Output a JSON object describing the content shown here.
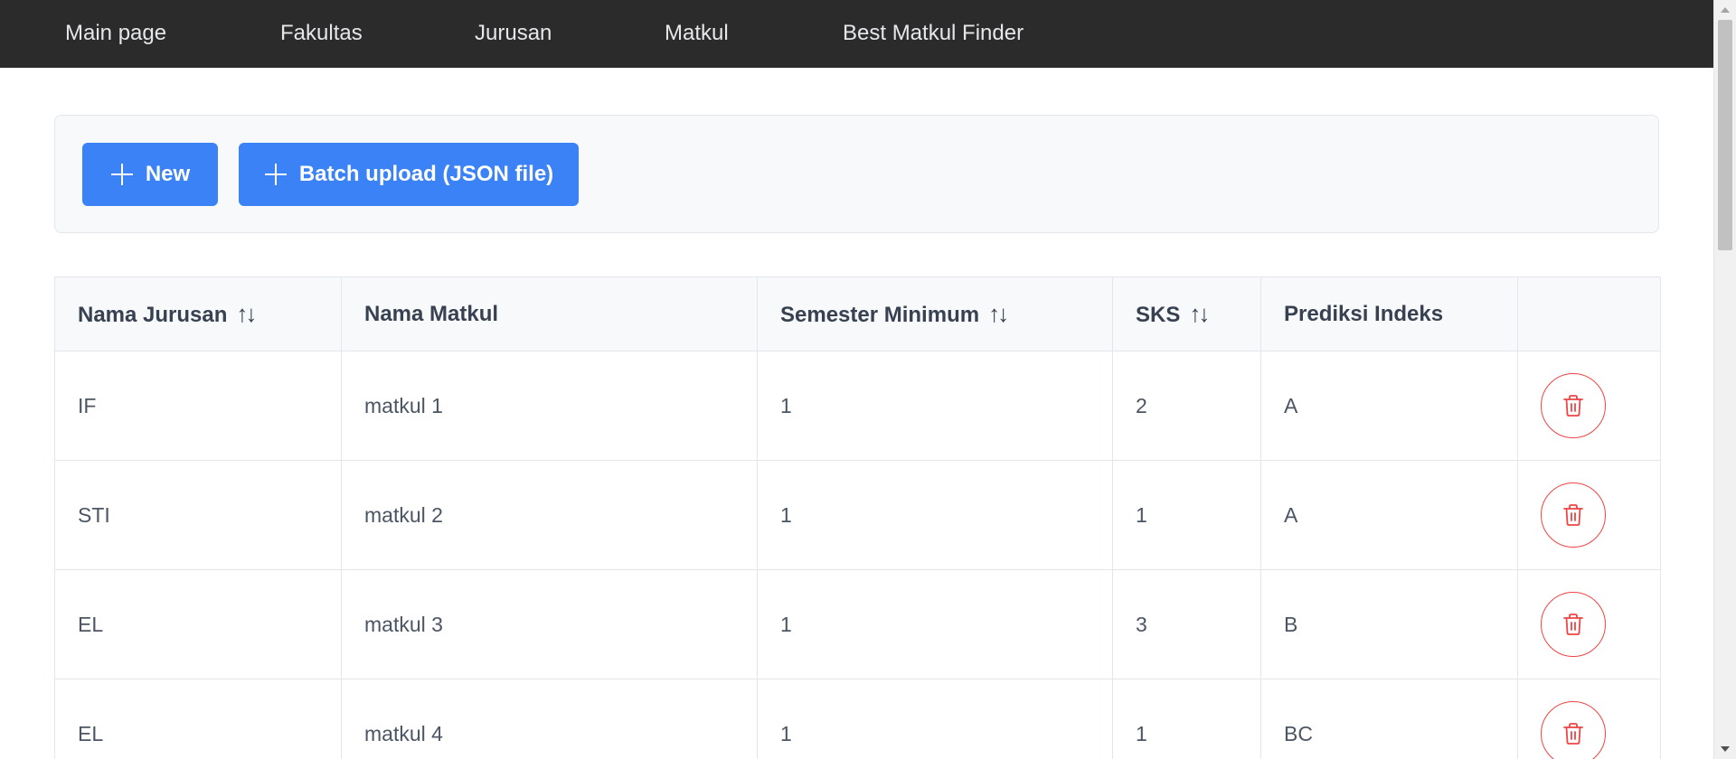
{
  "navbar": {
    "items": [
      {
        "label": "Main page"
      },
      {
        "label": "Fakultas"
      },
      {
        "label": "Jurusan"
      },
      {
        "label": "Matkul"
      },
      {
        "label": "Best Matkul Finder"
      }
    ]
  },
  "toolbar": {
    "new_label": "New",
    "batch_label": "Batch upload (JSON file)"
  },
  "table": {
    "headers": [
      {
        "label": "Nama Jurusan",
        "sortable": true
      },
      {
        "label": "Nama Matkul",
        "sortable": false
      },
      {
        "label": "Semester Minimum",
        "sortable": true
      },
      {
        "label": "SKS",
        "sortable": true
      },
      {
        "label": "Prediksi Indeks",
        "sortable": false
      },
      {
        "label": "",
        "sortable": false
      }
    ],
    "rows": [
      {
        "jurusan": "IF",
        "matkul": "matkul 1",
        "semester": "1",
        "sks": "2",
        "indeks": "A"
      },
      {
        "jurusan": "STI",
        "matkul": "matkul 2",
        "semester": "1",
        "sks": "1",
        "indeks": "A"
      },
      {
        "jurusan": "EL",
        "matkul": "matkul 3",
        "semester": "1",
        "sks": "3",
        "indeks": "B"
      },
      {
        "jurusan": "EL",
        "matkul": "matkul 4",
        "semester": "1",
        "sks": "1",
        "indeks": "BC"
      }
    ]
  },
  "icons": {
    "add": "plus-icon",
    "sort": "sort-arrows-icon",
    "delete": "trash-icon"
  },
  "colors": {
    "navbar_bg": "#2b2b2b",
    "primary": "#3b82f6",
    "danger": "#ef4444"
  }
}
